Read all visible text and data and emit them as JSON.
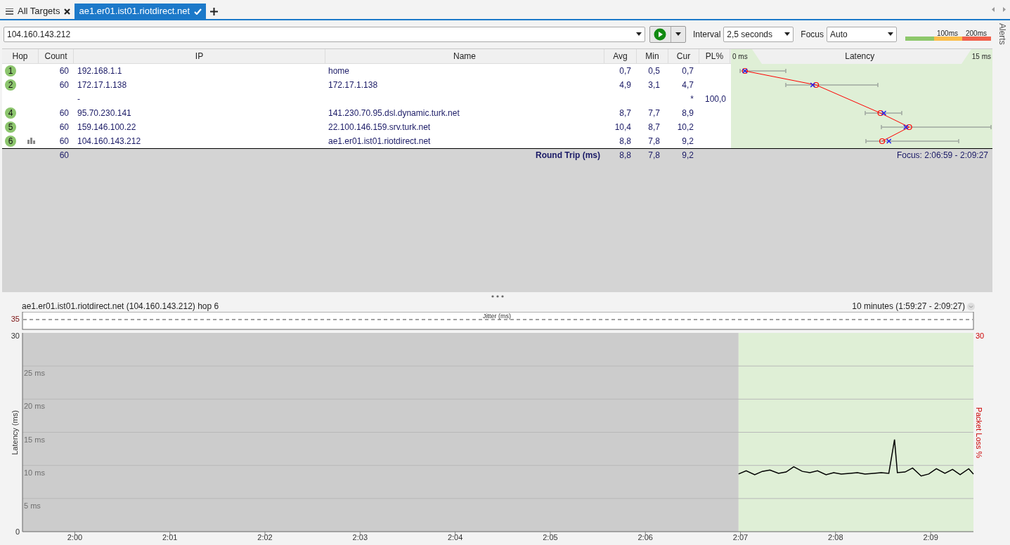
{
  "tabs": [
    {
      "kind": "list",
      "label": "All Targets",
      "selected": false
    },
    {
      "kind": "target",
      "label": "ae1.er01.ist01.riotdirect.net",
      "selected": true
    }
  ],
  "toolbar": {
    "target": "104.160.143.212",
    "interval_label": "Interval",
    "interval": "2,5 seconds",
    "focus_label": "Focus",
    "focus": "Auto",
    "scale_labels": [
      "100ms",
      "200ms"
    ]
  },
  "table": {
    "columns": [
      "Hop",
      "Count",
      "IP",
      "Name",
      "Avg",
      "Min",
      "Cur",
      "PL%"
    ],
    "latency_header": {
      "min": "0 ms",
      "title": "Latency",
      "max": "15 ms"
    },
    "rows": [
      {
        "hop": "1",
        "count": "60",
        "ip": "192.168.1.1",
        "name": "home",
        "avg": "0,7",
        "min": "0,5",
        "cur": "0,7",
        "graphed": false
      },
      {
        "hop": "2",
        "count": "60",
        "ip": "172.17.1.138",
        "name": "172.17.1.138",
        "avg": "4,9",
        "min": "3,1",
        "cur": "4,7",
        "graphed": false
      },
      {
        "ip": "-",
        "cur": "*",
        "pl": "100,0",
        "graphed": false
      },
      {
        "hop": "4",
        "count": "60",
        "ip": "95.70.230.141",
        "name": "141.230.70.95.dsl.dynamic.turk.net",
        "avg": "8,7",
        "min": "7,7",
        "cur": "8,9",
        "graphed": false
      },
      {
        "hop": "5",
        "count": "60",
        "ip": "159.146.100.22",
        "name": "22.100.146.159.srv.turk.net",
        "avg": "10,4",
        "min": "8,7",
        "cur": "10,2",
        "graphed": false
      },
      {
        "hop": "6",
        "count": "60",
        "ip": "104.160.143.212",
        "name": "ae1.er01.ist01.riotdirect.net",
        "avg": "8,8",
        "min": "7,8",
        "cur": "9,2",
        "graphed": true
      }
    ],
    "summary": {
      "count": "60",
      "label": "Round Trip (ms)",
      "avg": "8,8",
      "min": "7,8",
      "cur": "9,2",
      "focus": "Focus: 2:06:59 - 2:09:27"
    }
  },
  "graph": {
    "title": "ae1.er01.ist01.riotdirect.net (104.160.143.212) hop 6",
    "range": "10 minutes (1:59:27 - 2:09:27)",
    "jitter_label": "Jitter (ms)",
    "jitter_max": "35",
    "loss_label": "Packet Loss %",
    "loss_max": "30",
    "y_min_label": "0",
    "y_max_label": "30",
    "chart_data": {
      "type": "line",
      "ylabel": "Latency (ms)",
      "xlim": [
        119.45,
        129.45
      ],
      "ylim": [
        0,
        30
      ],
      "grid": true,
      "bands": [
        {
          "axis": "x",
          "from": 119.45,
          "to": 126.98,
          "color": "#cccccc"
        },
        {
          "axis": "x",
          "from": 126.98,
          "to": 129.45,
          "color": "#dfefd6"
        }
      ],
      "xticks": [
        {
          "value": 120,
          "label": "2:00"
        },
        {
          "value": 121,
          "label": "2:01"
        },
        {
          "value": 122,
          "label": "2:02"
        },
        {
          "value": 123,
          "label": "2:03"
        },
        {
          "value": 124,
          "label": "2:04"
        },
        {
          "value": 125,
          "label": "2:05"
        },
        {
          "value": 126,
          "label": "2:06"
        },
        {
          "value": 127,
          "label": "2:07"
        },
        {
          "value": 128,
          "label": "2:08"
        },
        {
          "value": 129,
          "label": "2:09"
        }
      ],
      "yticks": [
        {
          "value": 5,
          "label": "5 ms"
        },
        {
          "value": 10,
          "label": "10 ms"
        },
        {
          "value": 15,
          "label": "15 ms"
        },
        {
          "value": 20,
          "label": "20 ms"
        },
        {
          "value": 25,
          "label": "25 ms"
        }
      ],
      "x": [
        126.98,
        127.06,
        127.15,
        127.23,
        127.31,
        127.4,
        127.48,
        127.56,
        127.65,
        127.73,
        127.81,
        127.9,
        127.98,
        128.06,
        128.15,
        128.23,
        128.31,
        128.4,
        128.48,
        128.56,
        128.62,
        128.65,
        128.73,
        128.81,
        128.9,
        128.98,
        129.06,
        129.15,
        129.23,
        129.31,
        129.4,
        129.45
      ],
      "series": [
        {
          "color": "#000000",
          "values": [
            8.7,
            9.2,
            8.6,
            9.1,
            9.3,
            8.8,
            9.0,
            9.8,
            9.1,
            8.9,
            9.2,
            8.6,
            8.9,
            8.7,
            8.8,
            8.9,
            8.7,
            8.8,
            8.9,
            8.8,
            13.9,
            8.9,
            9.0,
            9.6,
            8.4,
            8.7,
            9.5,
            8.8,
            9.4,
            8.6,
            9.5,
            8.7
          ]
        }
      ]
    }
  },
  "alerts_label": "Alerts"
}
